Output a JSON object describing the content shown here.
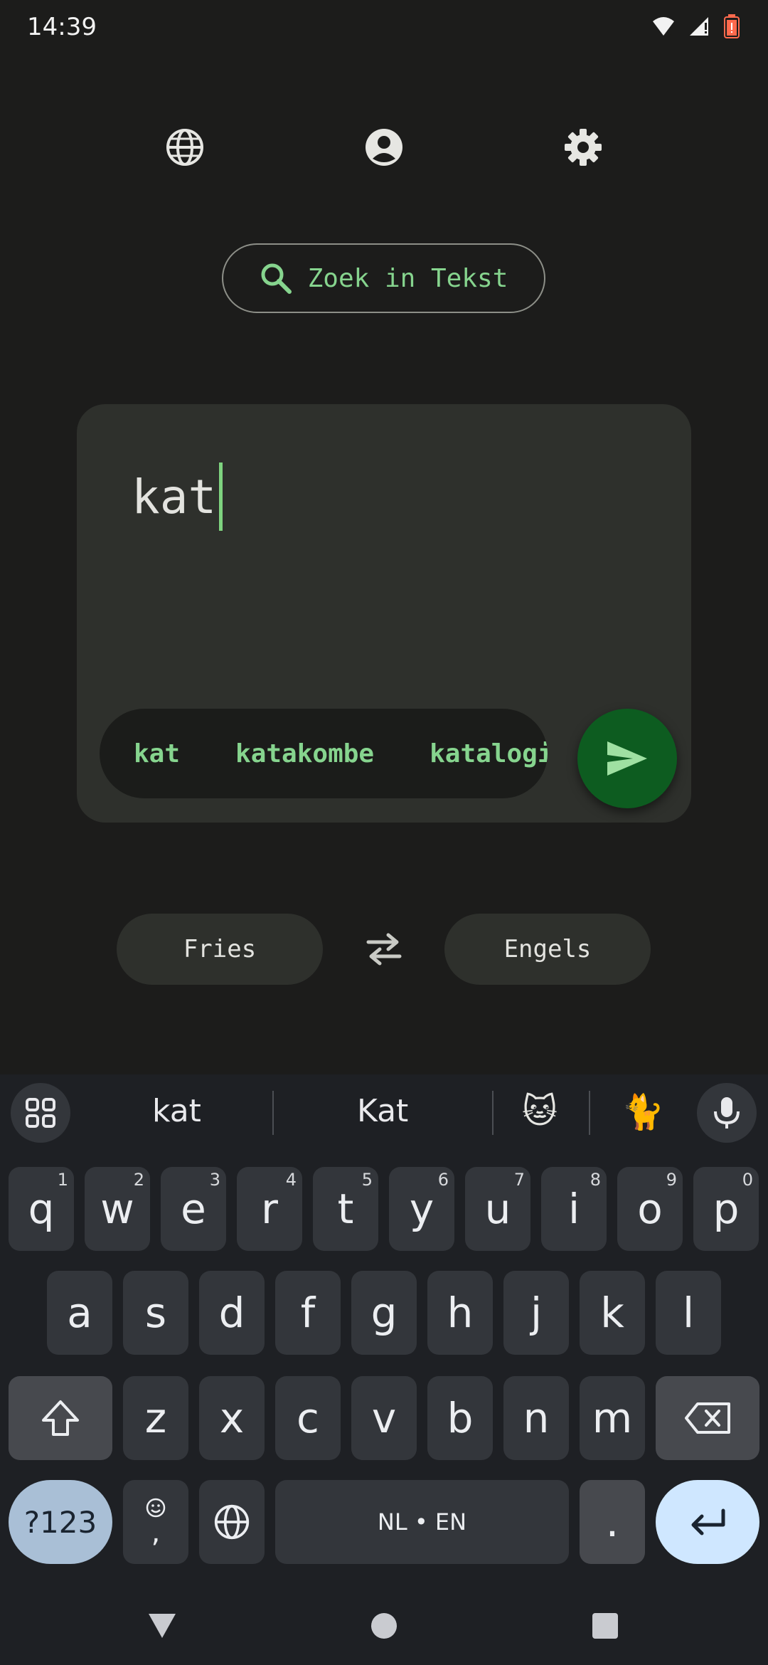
{
  "status_bar": {
    "time": "14:39"
  },
  "top_icons": [
    "globe-icon",
    "account-circle-icon",
    "gear-icon"
  ],
  "search": {
    "label": "Zoek in Tekst"
  },
  "input": {
    "value": "kat"
  },
  "suggestions": [
    "kat",
    "katakombe",
    "katalogis"
  ],
  "languages": {
    "source": "Fries",
    "target": "Engels"
  },
  "keyboard": {
    "suggestion_words": [
      "kat",
      "Kat"
    ],
    "suggestion_emojis": [
      "🐱",
      "🐈"
    ],
    "row1": [
      {
        "key": "q",
        "num": "1"
      },
      {
        "key": "w",
        "num": "2"
      },
      {
        "key": "e",
        "num": "3"
      },
      {
        "key": "r",
        "num": "4"
      },
      {
        "key": "t",
        "num": "5"
      },
      {
        "key": "y",
        "num": "6"
      },
      {
        "key": "u",
        "num": "7"
      },
      {
        "key": "i",
        "num": "8"
      },
      {
        "key": "o",
        "num": "9"
      },
      {
        "key": "p",
        "num": "0"
      }
    ],
    "row2": [
      "a",
      "s",
      "d",
      "f",
      "g",
      "h",
      "j",
      "k",
      "l"
    ],
    "row3": [
      "z",
      "x",
      "c",
      "v",
      "b",
      "n",
      "m"
    ],
    "symbols_label": "?123",
    "emoji_comma_label": ",",
    "space_label": "NL • EN",
    "period_label": "."
  },
  "colors": {
    "accent_green": "#86d48e",
    "send_button": "#0d5c20",
    "background": "#1c1c1b",
    "card": "#2e302c"
  }
}
